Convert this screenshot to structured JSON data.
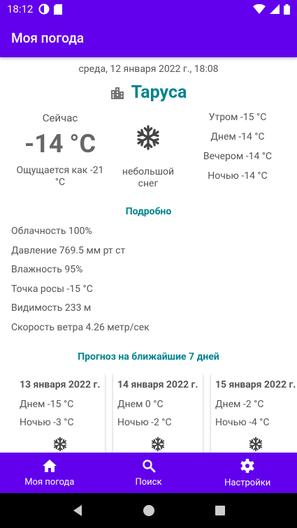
{
  "status_bar": {
    "time": "18:12"
  },
  "app_bar": {
    "title": "Моя погода"
  },
  "weather": {
    "datetime": "среда, 12 января 2022 г., 18:08",
    "city": "Таруса",
    "now_label": "Сейчас",
    "temperature": "-14 °C",
    "feels_like": "Ощущается как -21 °C",
    "condition": "небольшой снег",
    "periods": {
      "morning": "Утром -15 °C",
      "day": "Днем -14 °C",
      "evening": "Вечером -14 °C",
      "night": "Ночью -14 °C"
    }
  },
  "details": {
    "title": "Подробно",
    "items": [
      "Облачность 100%",
      "Давление 769.5 мм рт ст",
      "Влажность 95%",
      "Точка росы -15 °C",
      "Видимость 233 м",
      "Скорость ветра 4.26 метр/сек"
    ]
  },
  "forecast": {
    "title": "Прогноз на ближайшие 7 дней",
    "days": [
      {
        "date": "13 января 2022 г.",
        "day": "Днем -15 °C",
        "night": "Ночью -3 °C"
      },
      {
        "date": "14 января 2022 г.",
        "day": "Днем 0 °C",
        "night": "Ночью -2 °C"
      },
      {
        "date": "15 января 2022 г.",
        "day": "Днем -2 °C",
        "night": "Ночью -4 °C"
      }
    ]
  },
  "bottom_nav": {
    "my_weather": "Моя погода",
    "search": "Поиск",
    "settings": "Настройки"
  },
  "colors": {
    "primary": "#6200ee",
    "accent": "#00838f",
    "text": "#555555"
  }
}
